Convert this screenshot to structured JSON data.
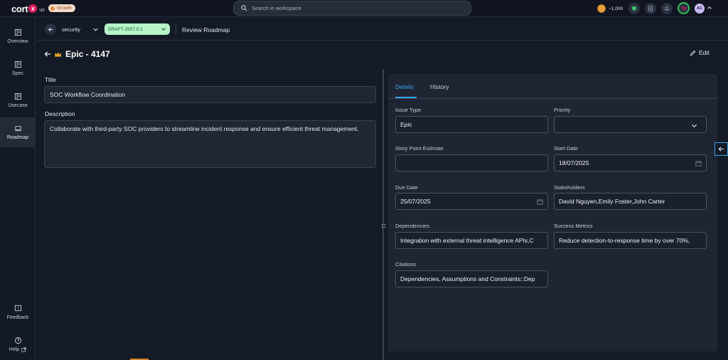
{
  "topbar": {
    "logo_text": "cort",
    "logo_mark": "x",
    "logo_region": "us",
    "plan_badge": "Growth",
    "search_placeholder": "Search in workspace",
    "credits": "~1,000",
    "avatar_initials": "AC"
  },
  "sidebar": {
    "items": [
      {
        "label": "Overview",
        "icon": "overview-icon"
      },
      {
        "label": "Spec",
        "icon": "spec-icon"
      },
      {
        "label": "Usecase",
        "icon": "usecase-icon"
      },
      {
        "label": "Roadmap",
        "icon": "roadmap-icon",
        "active": true
      }
    ],
    "feedback_label": "Feedback",
    "help_label": "Help"
  },
  "subheader": {
    "project": "security",
    "version": "DRAFT-2507.0.1",
    "breadcrumb": "Review Roadmap"
  },
  "page": {
    "title": "Epic - 4147",
    "edit_label": "Edit"
  },
  "form": {
    "title_label": "Title",
    "title_value": "SOC Workflow Coordination",
    "description_label": "Description",
    "description_value": "Collaborate with third-party SOC providers to streamline incident response and ensure efficient threat management."
  },
  "panel": {
    "tabs": [
      "Details",
      "History"
    ],
    "active_tab": "Details",
    "fields": {
      "issue_type": {
        "label": "Issue Type",
        "value": "Epic"
      },
      "priority": {
        "label": "Priority",
        "value": ""
      },
      "story_points": {
        "label": "Story Point Estimate",
        "value": ""
      },
      "start_date": {
        "label": "Start Date",
        "value": "18/07/2025"
      },
      "due_date": {
        "label": "Due Date",
        "value": "25/07/2025"
      },
      "stakeholders": {
        "label": "Stakeholders",
        "value": "David Nguyen,Emily Foster,John Carter"
      },
      "dependencies": {
        "label": "Dependencies",
        "value": "Integration with external threat intelligence APIs,C"
      },
      "success_metrics": {
        "label": "Success Metrics",
        "value": "Reduce detection-to-response time by over 70%,"
      },
      "citations": {
        "label": "Citations",
        "value": "Dependencies, Assumptions and Constraints::Dep"
      }
    }
  },
  "colors": {
    "accent": "#3aa4f0",
    "draft_badge": "#b6f3c8",
    "growth_badge": "#f3dcc7",
    "background": "#141a26"
  }
}
